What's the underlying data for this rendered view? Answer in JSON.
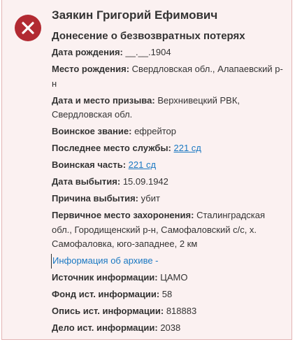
{
  "record": {
    "name": "Заякин Григорий Ефимович",
    "document_type": "Донесение о безвозвратных потерях",
    "status_color": "#b22a32"
  },
  "fields": {
    "birth_date": {
      "label": "Дата рождения:",
      "value": "__.__.1904"
    },
    "birth_place": {
      "label": "Место рождения:",
      "value": "Свердловская обл., Алапаевский р-н"
    },
    "draft": {
      "label": "Дата и место призыва:",
      "value": "Верхнивецкий РВК, Свердловская обл."
    },
    "rank": {
      "label": "Воинское звание:",
      "value": "ефрейтор"
    },
    "last_service": {
      "label": "Последнее место службы:",
      "value": "221 сд"
    },
    "unit": {
      "label": "Воинская часть:",
      "value": "221 сд"
    },
    "departure_date": {
      "label": "Дата выбытия:",
      "value": "15.09.1942"
    },
    "departure_reason": {
      "label": "Причина выбытия:",
      "value": "убит"
    },
    "burial": {
      "label": "Первичное место захоронения:",
      "value": "Сталинградская обл., Городищенский р-н, Самофаловский с/с, х. Самофаловка, юго-западнее, 2 км"
    }
  },
  "archive": {
    "link_label": "Информация об архиве -",
    "source": {
      "label": "Источник информации:",
      "value": "ЦАМО"
    },
    "fund": {
      "label": "Фонд ист. информации:",
      "value": "58"
    },
    "inventory": {
      "label": "Опись ист. информации:",
      "value": "818883"
    },
    "case": {
      "label": "Дело ист. информации:",
      "value": "2038"
    }
  },
  "icons": {
    "status": "close-circle-icon"
  }
}
